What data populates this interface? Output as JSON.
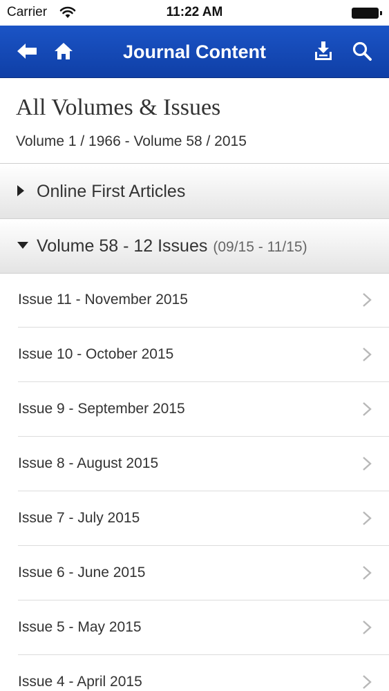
{
  "status_bar": {
    "carrier": "Carrier",
    "time": "11:22 AM"
  },
  "nav": {
    "title": "Journal Content",
    "icons": [
      "back-arrow-icon",
      "home-icon",
      "download-icon",
      "search-icon"
    ],
    "bar_color": "#1b54c6"
  },
  "header": {
    "title": "All Volumes & Issues",
    "subtitle": "Volume 1 / 1966 - Volume 58 / 2015"
  },
  "sections": [
    {
      "label": "Online First Articles",
      "expanded": false,
      "range": ""
    },
    {
      "label": "Volume 58 - 12 Issues",
      "expanded": true,
      "range": "(09/15 - 11/15)"
    }
  ],
  "issues": [
    {
      "label": "Issue 11 - November 2015"
    },
    {
      "label": "Issue 10 - October 2015"
    },
    {
      "label": "Issue 9 - September 2015"
    },
    {
      "label": "Issue 8 - August 2015"
    },
    {
      "label": "Issue 7 - July 2015"
    },
    {
      "label": "Issue 6 - June 2015"
    },
    {
      "label": "Issue 5 - May 2015"
    },
    {
      "label": "Issue 4 - April 2015"
    }
  ]
}
